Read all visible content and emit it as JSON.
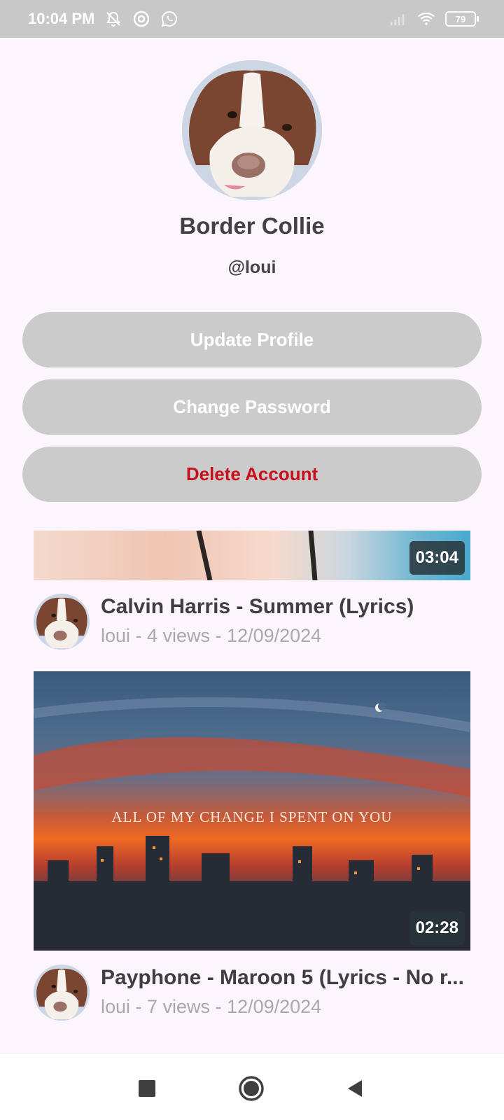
{
  "status_bar": {
    "time": "10:04 PM",
    "battery": "79",
    "icons_left": [
      "bell-off-icon",
      "circle-a-icon",
      "whatsapp-icon"
    ],
    "icons_right": [
      "signal-icon",
      "wifi-icon",
      "battery-icon"
    ]
  },
  "profile": {
    "name": "Border Collie",
    "handle": "@loui"
  },
  "actions": {
    "update_profile": "Update Profile",
    "change_password": "Change Password",
    "delete_account": "Delete Account"
  },
  "videos": [
    {
      "title": "Calvin Harris - Summer (Lyrics)",
      "meta": "loui - 4 views - 12/09/2024",
      "duration": "03:04"
    },
    {
      "title": "Payphone - Maroon 5 (Lyrics - No r...",
      "meta": "loui - 7 views - 12/09/2024",
      "duration": "02:28",
      "thumbnail_caption": "ALL OF MY CHANGE I SPENT ON YOU"
    }
  ],
  "colors": {
    "background": "#fcf5fd",
    "status_bar": "#c8c8c8",
    "button": "#cbcbcb",
    "danger": "#c8101c"
  }
}
